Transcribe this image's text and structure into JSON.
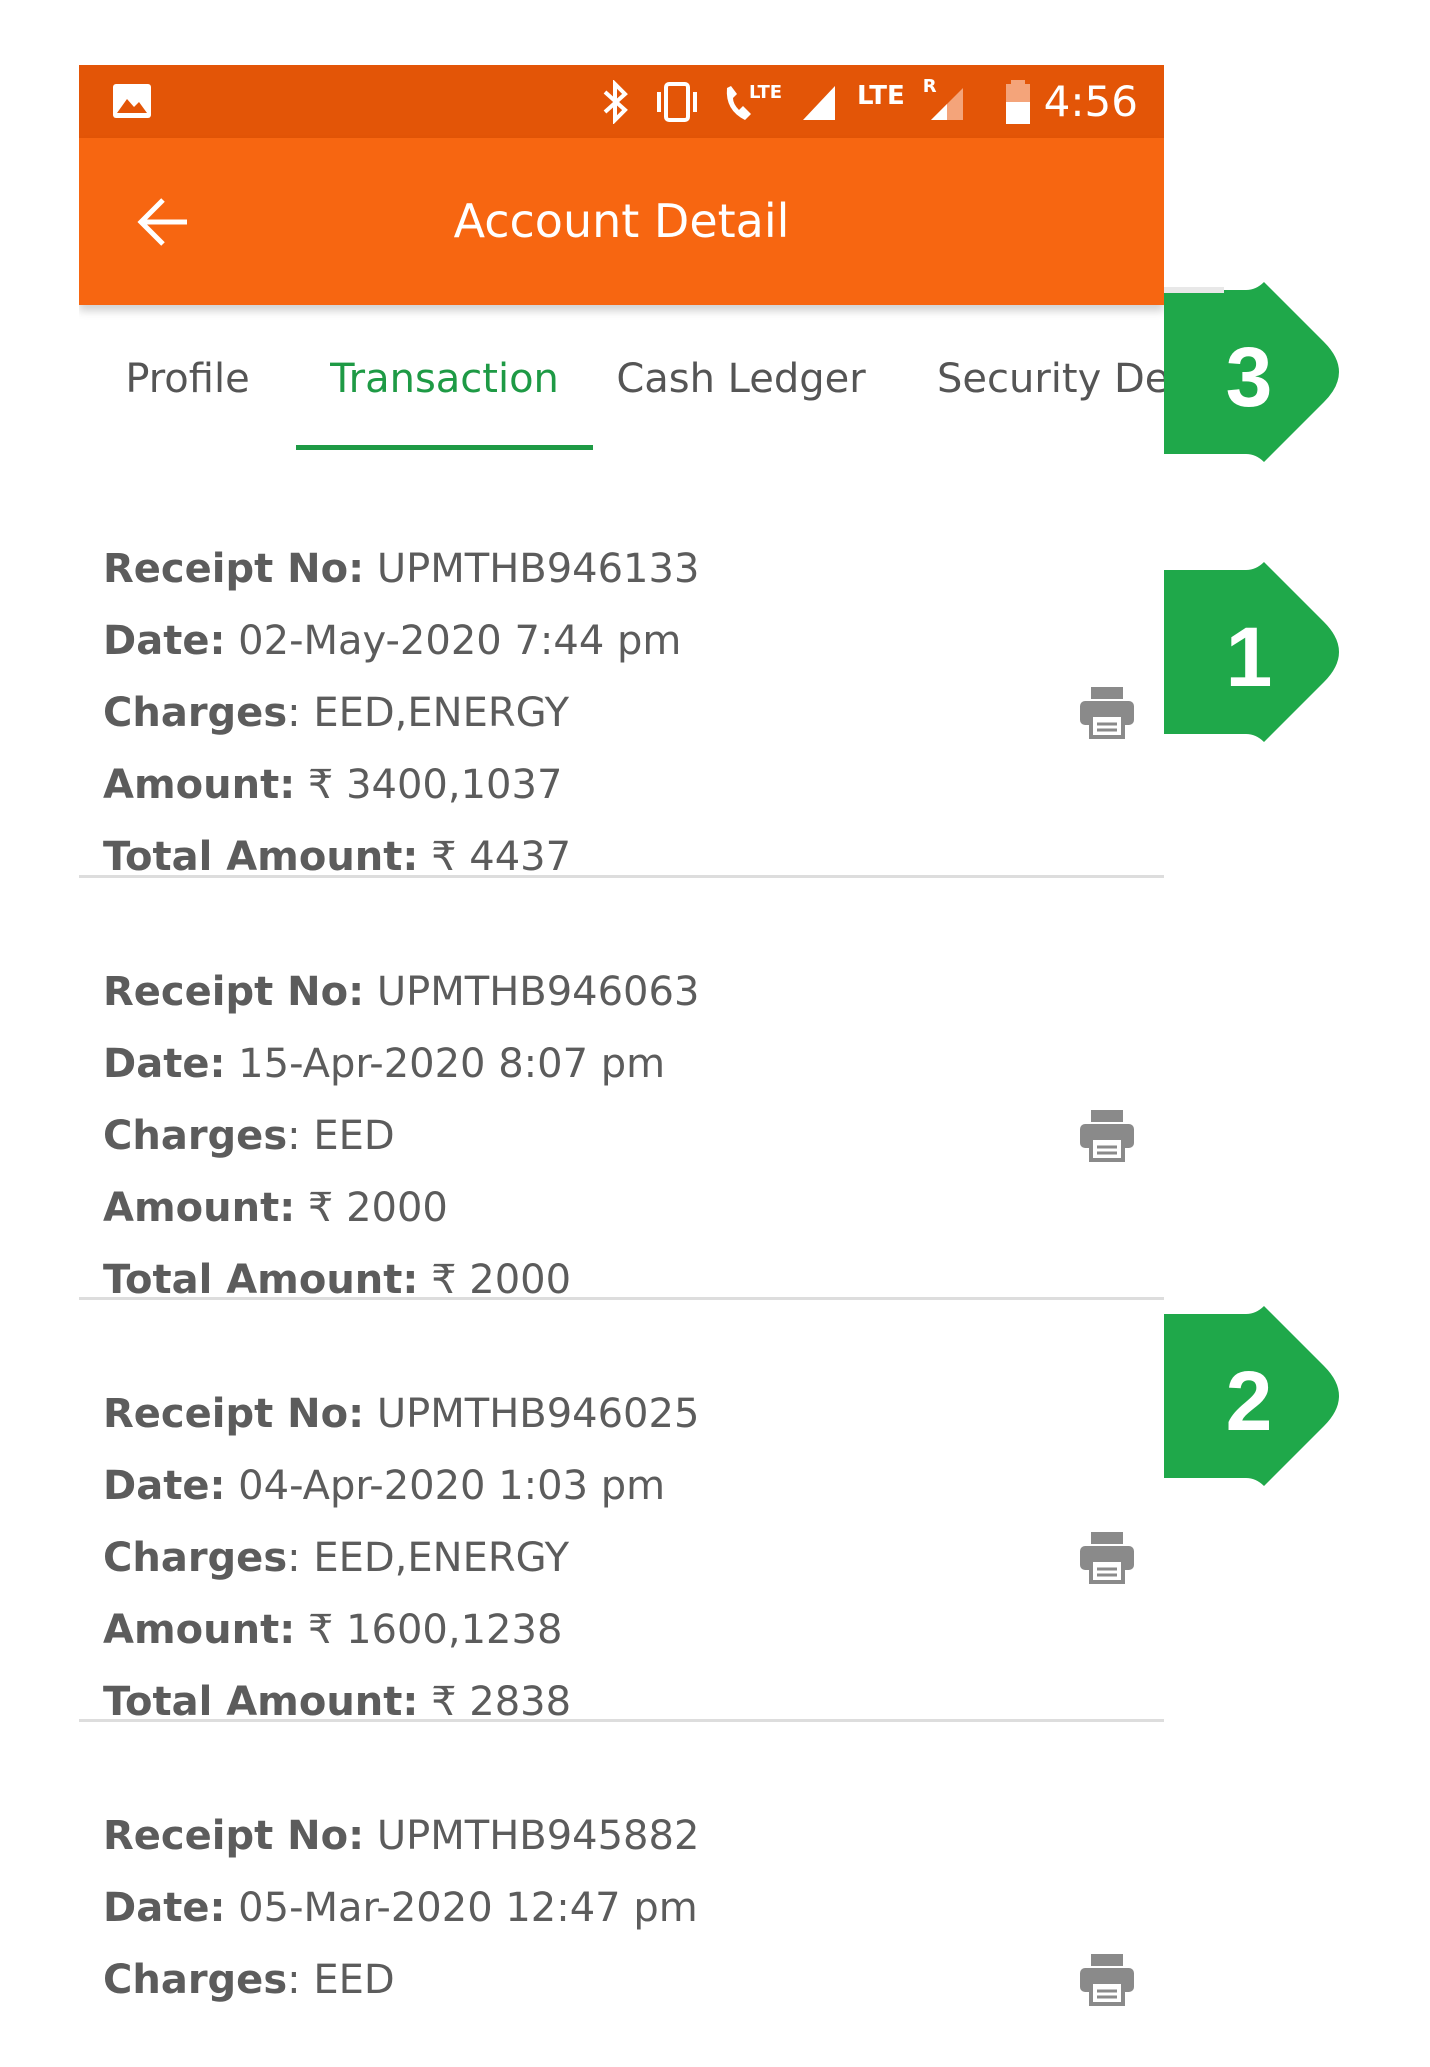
{
  "status_bar": {
    "network_label": "LTE",
    "roaming_label": "R",
    "time": "4:56"
  },
  "app_bar": {
    "title": "Account Detail",
    "back_icon": "arrow-left-icon"
  },
  "tabs": [
    {
      "label": "Profile",
      "active": false
    },
    {
      "label": "Transaction",
      "active": true
    },
    {
      "label": "Cash Ledger",
      "active": false
    },
    {
      "label": "Security Dep",
      "active": false
    }
  ],
  "field_labels": {
    "receipt": "Receipt No:",
    "date": "Date:",
    "charges": "Charges",
    "amount": "Amount:",
    "total": "Total Amount:"
  },
  "currency_symbol": "₹",
  "receipts": [
    {
      "receipt_no": "UPMTHB946133",
      "date": "02-May-2020 7:44 pm",
      "charges": "EED,ENERGY",
      "amount": "3400,1037",
      "total": "4437"
    },
    {
      "receipt_no": "UPMTHB946063",
      "date": "15-Apr-2020 8:07 pm",
      "charges": "EED",
      "amount": "2000",
      "total": "2000"
    },
    {
      "receipt_no": "UPMTHB946025",
      "date": "04-Apr-2020 1:03 pm",
      "charges": "EED,ENERGY",
      "amount": "1600,1238",
      "total": "2838"
    },
    {
      "receipt_no": "UPMTHB945882",
      "date": "05-Mar-2020 12:47 pm",
      "charges": "EED"
    }
  ],
  "callouts": [
    {
      "number": "3",
      "target": "tabs"
    },
    {
      "number": "1",
      "target": "print-button"
    },
    {
      "number": "2",
      "target": "print-button"
    }
  ],
  "colors": {
    "status_bar": "#e35507",
    "app_bar": "#f76611",
    "tab_active": "#1e9a45",
    "callout": "#1fa84a",
    "text": "#5c5c5c"
  }
}
